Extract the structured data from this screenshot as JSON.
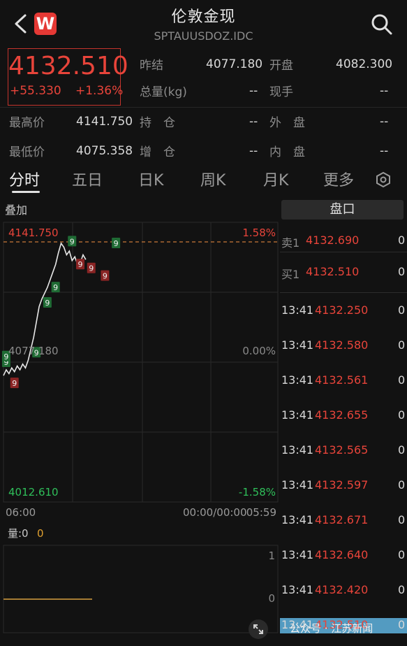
{
  "header": {
    "title": "伦敦金现",
    "code": "SPTAUUSDOZ.IDC",
    "logo_letter": "W"
  },
  "quote": {
    "price": "4132.510",
    "change": "+55.330",
    "change_pct": "+1.36%",
    "prev_close_label": "昨结",
    "prev_close": "4077.180",
    "open_label": "开盘",
    "open": "4082.300",
    "total_vol_label": "总量(kg)",
    "total_vol": "--",
    "cur_vol_label": "现手",
    "cur_vol": "--",
    "high_label": "最高价",
    "high": "4141.750",
    "position_label": "持　仓",
    "position": "--",
    "outer_label": "外　盘",
    "outer": "--",
    "low_label": "最低价",
    "low": "4075.358",
    "increase_label": "增　仓",
    "increase": "--",
    "inner_label": "内　盘",
    "inner": "--"
  },
  "tabs": [
    {
      "label": "分时"
    },
    {
      "label": "五日"
    },
    {
      "label": "日K"
    },
    {
      "label": "周K"
    },
    {
      "label": "月K"
    },
    {
      "label": "更多"
    }
  ],
  "chart": {
    "overlay_label": "叠加",
    "top_price": "4141.750",
    "top_pct": "1.58%",
    "mid_price": "4077.180",
    "mid_pct": "0.00%",
    "bottom_price": "4012.610",
    "bottom_pct": "-1.58%",
    "time_start": "06:00",
    "time_mid": "00:00/00:00",
    "time_end": "05:59",
    "vol_label": "量:0",
    "vol_value": "0",
    "vol_axis_top": "1",
    "vol_axis_bottom": "0"
  },
  "chart_data": {
    "type": "line",
    "y_range": [
      4012.61,
      4141.75
    ],
    "x_range": [
      0,
      100
    ],
    "prev_close": 4077.18,
    "x": [
      0,
      1,
      2,
      3,
      4,
      5,
      6,
      7,
      8,
      9,
      10,
      11,
      12,
      13,
      14,
      15,
      16,
      17,
      18,
      19,
      20,
      21,
      22,
      23,
      24,
      25,
      26,
      27,
      28,
      29,
      30
    ],
    "values": [
      4072,
      4075,
      4073,
      4076,
      4074,
      4077,
      4075,
      4078,
      4076,
      4080,
      4086,
      4092,
      4100,
      4108,
      4112,
      4115,
      4118,
      4122,
      4126,
      4130,
      4136,
      4141,
      4139,
      4135,
      4137,
      4132,
      4134,
      4130,
      4131,
      4135,
      4132.51
    ],
    "markers": [
      {
        "x": 1,
        "y": 4079,
        "label": "9",
        "color": "green"
      },
      {
        "x": 1,
        "y": 4082,
        "label": "9",
        "color": "green"
      },
      {
        "x": 4,
        "y": 4068,
        "label": "9",
        "color": "red"
      },
      {
        "x": 12,
        "y": 4084,
        "label": "9",
        "color": "green"
      },
      {
        "x": 16,
        "y": 4110,
        "label": "9",
        "color": "green"
      },
      {
        "x": 19,
        "y": 4118,
        "label": "9",
        "color": "green"
      },
      {
        "x": 25,
        "y": 4142,
        "label": "9",
        "color": "green"
      },
      {
        "x": 28,
        "y": 4130,
        "label": "9",
        "color": "red"
      },
      {
        "x": 32,
        "y": 4128,
        "label": "9",
        "color": "red"
      },
      {
        "x": 37,
        "y": 4124,
        "label": "9",
        "color": "red"
      },
      {
        "x": 41,
        "y": 4141,
        "label": "9",
        "color": "green"
      }
    ]
  },
  "panel": {
    "header": "盘口",
    "sell": {
      "label": "卖1",
      "price": "4132.690",
      "vol": "0"
    },
    "buy": {
      "label": "买1",
      "price": "4132.510",
      "vol": "0"
    },
    "trades": [
      {
        "time": "13:41",
        "price": "4132.250",
        "vol": "0"
      },
      {
        "time": "13:41",
        "price": "4132.580",
        "vol": "0"
      },
      {
        "time": "13:41",
        "price": "4132.561",
        "vol": "0"
      },
      {
        "time": "13:41",
        "price": "4132.655",
        "vol": "0"
      },
      {
        "time": "13:41",
        "price": "4132.565",
        "vol": "0"
      },
      {
        "time": "13:41",
        "price": "4132.597",
        "vol": "0"
      },
      {
        "time": "13:41",
        "price": "4132.671",
        "vol": "0"
      },
      {
        "time": "13:41",
        "price": "4132.640",
        "vol": "0"
      },
      {
        "time": "13:41",
        "price": "4132.420",
        "vol": "0"
      },
      {
        "time": "13:41",
        "price": "4132.510",
        "vol": "0"
      }
    ]
  },
  "watermark": "公众号 · 江苏新闻"
}
